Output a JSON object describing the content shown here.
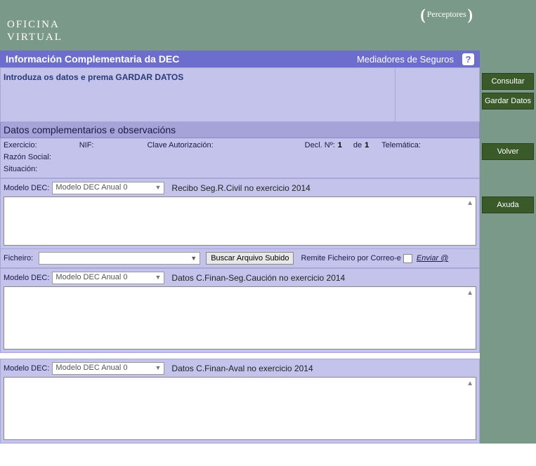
{
  "brand": {
    "line1": "OFICINA",
    "line2": "VIRTUAL"
  },
  "perceptores": "Perceptores",
  "header": {
    "title": "Información Complementaria da DEC",
    "subtitle": "Mediadores de Seguros",
    "help": "?"
  },
  "instruction": "Introduza os datos e prema GARDAR DATOS",
  "section_header": "Datos complementarios e observacións",
  "info": {
    "exercicio": "Exercicio:",
    "nif": "NIF:",
    "clave": "Clave Autorización:",
    "decl_label": "Decl. Nº:",
    "decl_num": "1",
    "de_label": "de",
    "de_num": "1",
    "telematica": "Telemática:",
    "razon": "Razón Social:",
    "situacion": "Situación:"
  },
  "model_label": "Modelo DEC:",
  "model_selected": "Modelo DEC Anual 0",
  "blocks": [
    {
      "title": "Recibo Seg.R.Civil no exercicio 2014"
    },
    {
      "title": "Datos C.Finan-Seg.Caución no exercicio 2014"
    },
    {
      "title": "Datos C.Finan-Aval no exercicio 2014"
    }
  ],
  "file": {
    "label": "Ficheiro:",
    "buscar": "Buscar Arquivo Subido",
    "remite": "Remite Ficheiro por Correo-e",
    "enviar": "Enviar @"
  },
  "buttons": {
    "consultar": "Consultar",
    "gardar": "Gardar Datos",
    "volver": "Volver",
    "axuda": "Axuda"
  }
}
